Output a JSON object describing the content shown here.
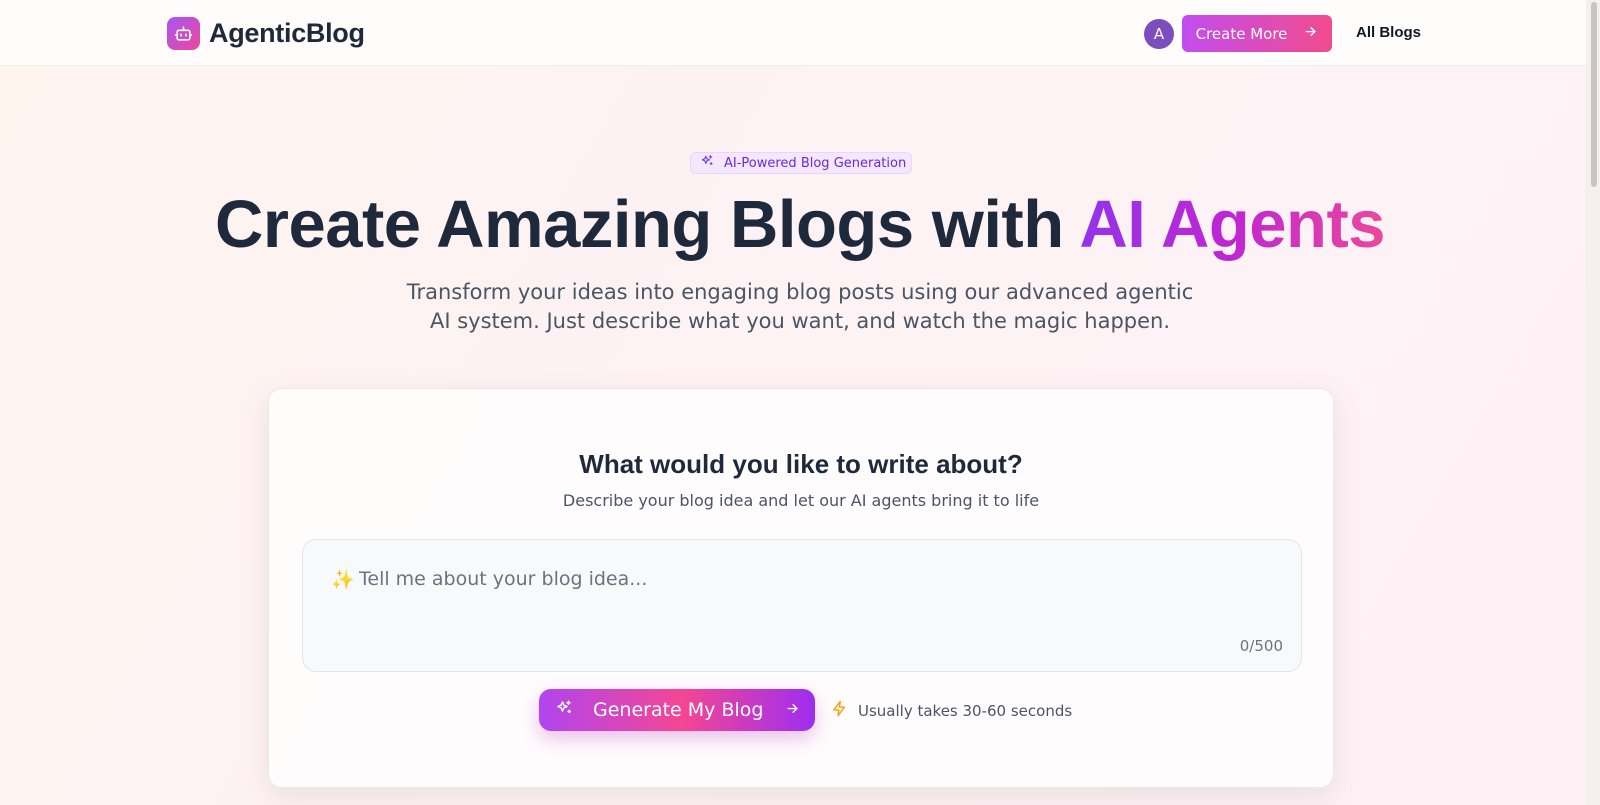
{
  "header": {
    "brand_name": "AgenticBlog",
    "avatar_initial": "A",
    "create_more_label": "Create More",
    "all_blogs_label": "All Blogs"
  },
  "hero": {
    "badge_text": "AI-Powered Blog Generation",
    "title_main": "Create Amazing Blogs with ",
    "title_accent": "AI Agents",
    "subtitle_line1": "Transform your ideas into engaging blog posts using our advanced agentic",
    "subtitle_line2": "AI system. Just describe what you want, and watch the magic happen."
  },
  "composer": {
    "title": "What would you like to write about?",
    "subtitle": "Describe your blog idea and let our AI agents bring it to life",
    "prompt_value": "",
    "prompt_placeholder": "Tell me about your blog idea...",
    "char_count": "0/500",
    "generate_label": "Generate My Blog",
    "eta_text": "Usually takes 30-60 seconds"
  },
  "icons": {
    "brand": "robot-icon",
    "arrow": "arrow-right-icon",
    "sparkles": "sparkles-icon",
    "lightning": "lightning-icon"
  },
  "colors": {
    "accent_purple": "#a855f7",
    "accent_pink": "#ec4899",
    "text_dark": "#1e293b",
    "avatar": "#7c4dbd"
  }
}
